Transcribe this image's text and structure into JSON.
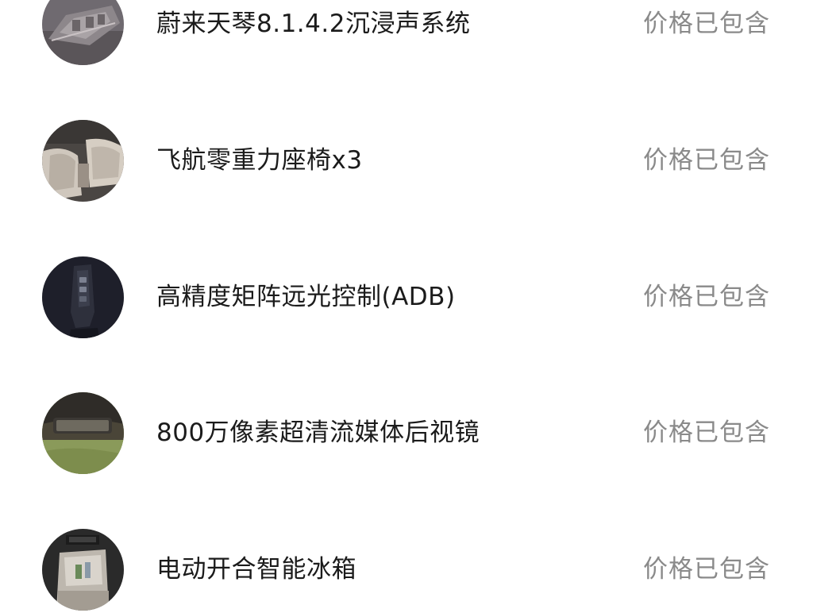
{
  "features": [
    {
      "name": "蔚来天琴8.1.4.2沉浸声系统",
      "price_status": "价格已包含",
      "icon": "car-cabin-audio-icon"
    },
    {
      "name": "飞航零重力座椅x3",
      "price_status": "价格已包含",
      "icon": "zero-gravity-seat-icon"
    },
    {
      "name": "高精度矩阵远光控制(ADB)",
      "price_status": "价格已包含",
      "icon": "headlight-control-icon"
    },
    {
      "name": "800万像素超清流媒体后视镜",
      "price_status": "价格已包含",
      "icon": "streaming-rearview-mirror-icon"
    },
    {
      "name": "电动开合智能冰箱",
      "price_status": "价格已包含",
      "icon": "smart-fridge-icon"
    }
  ]
}
